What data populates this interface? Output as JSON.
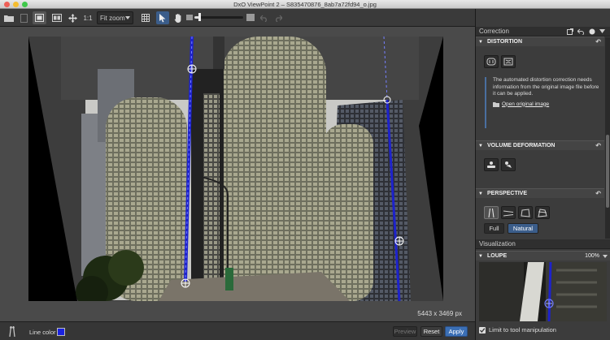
{
  "window": {
    "title": "DxO ViewPoint 2 – S835470876_8ab7a72fd94_o.jpg"
  },
  "toolbar": {
    "one_to_one": "1:1",
    "zoom_value": "Fit zoom"
  },
  "image": {
    "dimensions": "5443 x 3469 px"
  },
  "bottom": {
    "line_color_label": "Line color",
    "line_color": "#1a22e0",
    "preview": "Preview",
    "reset": "Reset",
    "apply": "Apply"
  },
  "panel": {
    "correction_title": "Correction",
    "distortion": {
      "title": "DISTORTION",
      "message": "The automated distortion correction needs information from the original image file before it can be applied.",
      "open_link": "Open original image"
    },
    "volume": {
      "title": "VOLUME DEFORMATION"
    },
    "perspective": {
      "title": "PERSPECTIVE",
      "full": "Full",
      "natural": "Natural"
    },
    "visualization_title": "Visualization",
    "loupe": {
      "title": "LOUPE",
      "zoom": "100%"
    },
    "limit_label": "Limit to tool manipulation"
  },
  "colors": {
    "accent": "#3b6fb5",
    "guide": "#1d22cc"
  }
}
